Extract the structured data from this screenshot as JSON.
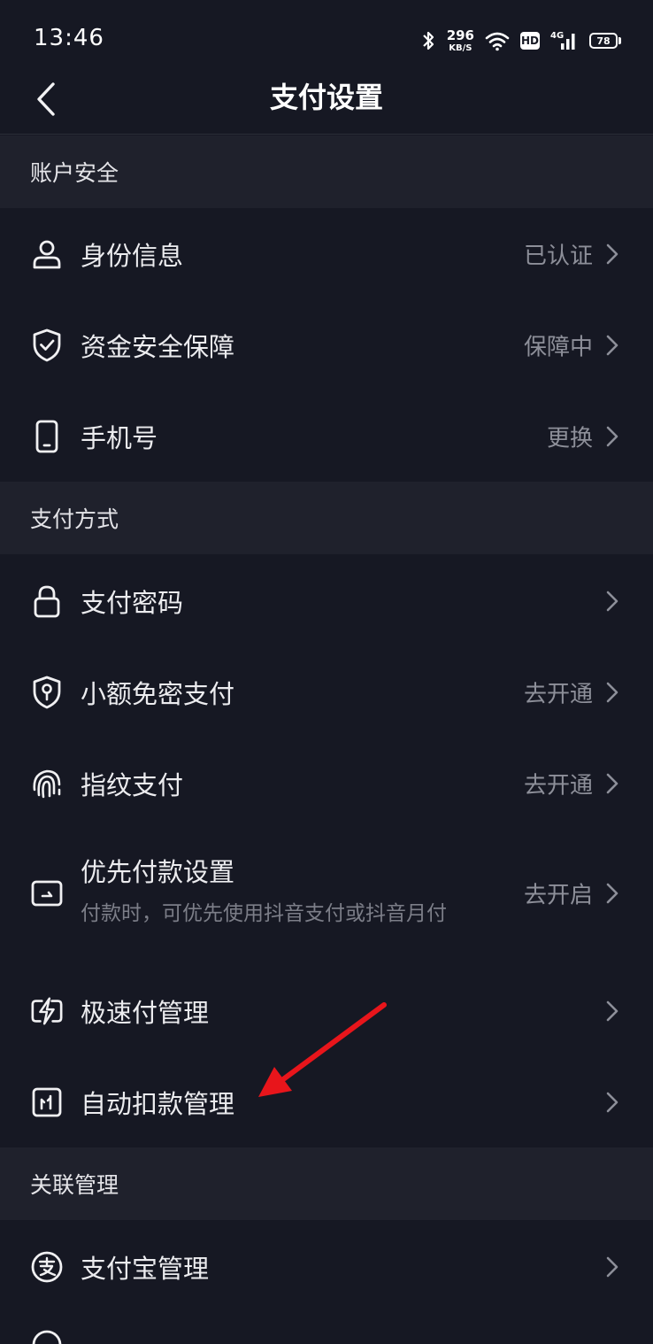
{
  "status_bar": {
    "time": "13:46",
    "net_speed_value": "296",
    "net_speed_unit": "KB/S",
    "hd": "HD",
    "network": "4G",
    "battery": "78"
  },
  "header": {
    "title": "支付设置",
    "back_icon": "chevron-left-icon"
  },
  "sections": {
    "account_security": {
      "title": "账户安全",
      "items": [
        {
          "label": "身份信息",
          "value": "已认证",
          "icon": "person-icon"
        },
        {
          "label": "资金安全保障",
          "value": "保障中",
          "icon": "shield-check-icon"
        },
        {
          "label": "手机号",
          "value": "更换",
          "icon": "phone-icon"
        }
      ]
    },
    "payment_methods": {
      "title": "支付方式",
      "items": [
        {
          "label": "支付密码",
          "value": "",
          "icon": "lock-icon"
        },
        {
          "label": "小额免密支付",
          "value": "去开通",
          "icon": "shield-key-icon"
        },
        {
          "label": "指纹支付",
          "value": "去开通",
          "icon": "fingerprint-icon"
        },
        {
          "label": "优先付款设置",
          "subtitle": "付款时，可优先使用抖音支付或抖音月付",
          "value": "去开启",
          "icon": "priority-payment-icon"
        },
        {
          "label": "极速付管理",
          "value": "",
          "icon": "lightning-card-icon"
        },
        {
          "label": "自动扣款管理",
          "value": "",
          "icon": "auto-debit-icon"
        }
      ]
    },
    "linked": {
      "title": "关联管理",
      "items": [
        {
          "label": "支付宝管理",
          "value": "",
          "icon": "alipay-icon"
        }
      ]
    }
  },
  "annotation": {
    "arrow_color": "#e8151b",
    "icon": "red-arrow-icon"
  },
  "colors": {
    "background": "#161823",
    "section_bg": "#1f212c",
    "primary_text": "#ececef",
    "secondary_text": "#8d8f99"
  }
}
